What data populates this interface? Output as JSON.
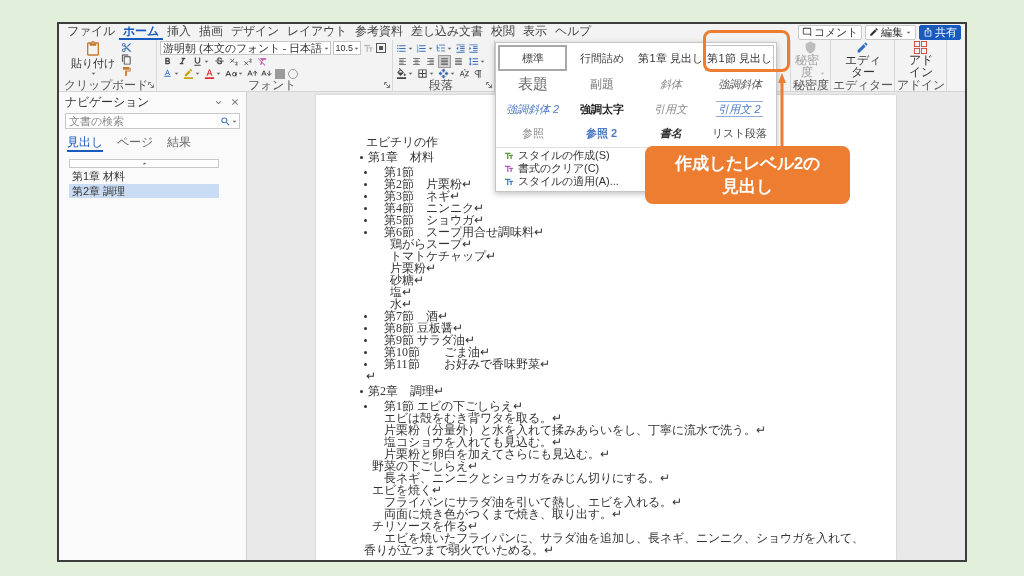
{
  "menu_tabs": [
    {
      "label": "ファイル",
      "selected": false
    },
    {
      "label": "ホーム",
      "selected": true
    },
    {
      "label": "挿入",
      "selected": false
    },
    {
      "label": "描画",
      "selected": false
    },
    {
      "label": "デザイン",
      "selected": false
    },
    {
      "label": "レイアウト",
      "selected": false
    },
    {
      "label": "参考資料",
      "selected": false
    },
    {
      "label": "差し込み文書",
      "selected": false
    },
    {
      "label": "校閲",
      "selected": false
    },
    {
      "label": "表示",
      "selected": false
    },
    {
      "label": "ヘルプ",
      "selected": false
    }
  ],
  "title_actions": [
    {
      "kind": "comment",
      "label": "コメント"
    },
    {
      "kind": "editing",
      "label": "編集"
    },
    {
      "kind": "share",
      "label": "共有"
    }
  ],
  "ribbon": {
    "clipboard": {
      "paste_label": "貼り付け",
      "group_label": "クリップボード"
    },
    "font": {
      "font_name": "游明朝 (本文のフォント - 日本語",
      "font_size": "10.5",
      "group_label": "フォント"
    },
    "paragraph": {
      "alignment": [
        {
          "kind": "left",
          "selected": false
        },
        {
          "kind": "center",
          "selected": false
        },
        {
          "kind": "right",
          "selected": false
        },
        {
          "kind": "justify",
          "selected": true
        },
        {
          "kind": "distributed",
          "selected": false
        }
      ],
      "group_label": "段落"
    },
    "sensitivity": {
      "button_label": "秘密度",
      "disabled": true,
      "group_label": "秘密度"
    },
    "editor": {
      "button_label": "エディター",
      "group_label": "エディター"
    },
    "addins": {
      "button_label": "アドイン",
      "group_label": "アドイン"
    }
  },
  "style_gallery": {
    "styles": [
      {
        "label": "標準",
        "kind": "normal",
        "selected": true,
        "hovered": false
      },
      {
        "label": "行間詰め",
        "kind": "normal",
        "selected": false,
        "hovered": false
      },
      {
        "label": "第1章 見出し",
        "kind": "heading",
        "selected": false,
        "hovered": false
      },
      {
        "label": "第1節 見出し",
        "kind": "heading",
        "selected": false,
        "hovered": true
      },
      {
        "label": "表題",
        "kind": "title",
        "selected": false,
        "hovered": false
      },
      {
        "label": "副題",
        "kind": "subtitle",
        "selected": false,
        "hovered": false
      },
      {
        "label": "斜体",
        "kind": "subtle_emphasis",
        "selected": false,
        "hovered": false
      },
      {
        "label": "強調斜体",
        "kind": "emphasis",
        "selected": false,
        "hovered": false
      },
      {
        "label": "強調斜体 2",
        "kind": "intense_emphasis",
        "selected": false,
        "hovered": false
      },
      {
        "label": "強調太字",
        "kind": "strong",
        "selected": false,
        "hovered": false
      },
      {
        "label": "引用文",
        "kind": "quote",
        "selected": false,
        "hovered": false
      },
      {
        "label": "引用文 2",
        "kind": "intense_quote",
        "selected": false,
        "hovered": false
      },
      {
        "label": "参照",
        "kind": "subtle_reference",
        "selected": false,
        "hovered": false
      },
      {
        "label": "参照 2",
        "kind": "intense_reference",
        "selected": false,
        "hovered": false
      },
      {
        "label": "書名",
        "kind": "book_title",
        "selected": false,
        "hovered": false
      },
      {
        "label": "リスト段落",
        "kind": "normal",
        "selected": false,
        "hovered": false
      }
    ],
    "menu": [
      {
        "kind": "create",
        "label": "スタイルの作成(S)"
      },
      {
        "kind": "clear",
        "label": "書式のクリア(C)"
      },
      {
        "kind": "apply",
        "label": "スタイルの適用(A)..."
      }
    ]
  },
  "navigation": {
    "title": "ナビゲーション",
    "search": {
      "placeholder": "文書の検索"
    },
    "tabs": [
      {
        "label": "見出し",
        "selected": true
      },
      {
        "label": "ページ",
        "selected": false
      },
      {
        "label": "結果",
        "selected": false
      }
    ],
    "headings": [
      {
        "label": "第1章 材料",
        "selected": false
      },
      {
        "label": "第2章 調理",
        "selected": true
      }
    ]
  },
  "document": {
    "lines": [
      {
        "kind": "title",
        "text": "エビチリの作"
      },
      {
        "kind": "chapter",
        "text": "第1章　材料"
      },
      {
        "kind": "section",
        "text": "第1節"
      },
      {
        "kind": "section",
        "text": "第2節　片栗粉↵"
      },
      {
        "kind": "section",
        "text": "第3節　ネギ↵"
      },
      {
        "kind": "section",
        "text": "第4節　ニンニク↵"
      },
      {
        "kind": "section",
        "text": "第5節　ショウガ↵"
      },
      {
        "kind": "section",
        "text": "第6節　スープ用合せ調味料↵"
      },
      {
        "kind": "item",
        "text": "鶏がらスープ↵"
      },
      {
        "kind": "item",
        "text": "トマトケチャップ↵"
      },
      {
        "kind": "item",
        "text": "片栗粉↵"
      },
      {
        "kind": "item",
        "text": "砂糖↵"
      },
      {
        "kind": "item",
        "text": "塩↵"
      },
      {
        "kind": "item",
        "text": "水↵"
      },
      {
        "kind": "section",
        "text": "第7節　酒↵"
      },
      {
        "kind": "section",
        "text": "第8節 豆板醤↵"
      },
      {
        "kind": "section",
        "text": "第9節 サラダ油↵"
      },
      {
        "kind": "section",
        "text": "第10節　　ごま油↵"
      },
      {
        "kind": "section",
        "text": "第11節　　お好みで香味野菜↵"
      },
      {
        "kind": "mark",
        "text": "↵"
      },
      {
        "kind": "chapter",
        "text": "第2章　調理↵"
      },
      {
        "kind": "section",
        "text": "第1節 エビの下ごしらえ↵"
      },
      {
        "kind": "step",
        "text": "エビは殻をむき背ワタを取る。↵"
      },
      {
        "kind": "step",
        "text": "片栗粉（分量外）と水を入れて揉みあらいをし、丁寧に流水で洗う。↵"
      },
      {
        "kind": "step",
        "text": "塩コショウを入れても見込む。↵"
      },
      {
        "kind": "step",
        "text": "片栗粉と卵白を加えてさらにも見込む。↵"
      },
      {
        "kind": "subheading",
        "text": "野菜の下ごしらえ↵"
      },
      {
        "kind": "step",
        "text": "長ネギ、ニンニクとショウガをみじん切りにする。↵"
      },
      {
        "kind": "subheading",
        "text": "エビを焼く↵"
      },
      {
        "kind": "step",
        "text": "フライパンにサラダ油を引いて熱し、エビを入れる。↵"
      },
      {
        "kind": "step",
        "text": "両面に焼き色がつくまで焼き、取り出す。↵"
      },
      {
        "kind": "subheading",
        "text": "チリソースを作る↵"
      },
      {
        "kind": "step",
        "text": "エビを焼いたフライパンに、サラダ油を追加し、長ネギ、ニンニク、ショウガを入れて、"
      },
      {
        "kind": "continuation",
        "text": "香りが立つまで弱火でいためる。↵"
      }
    ]
  },
  "callout": {
    "text": "作成したレベル2の見出し"
  }
}
